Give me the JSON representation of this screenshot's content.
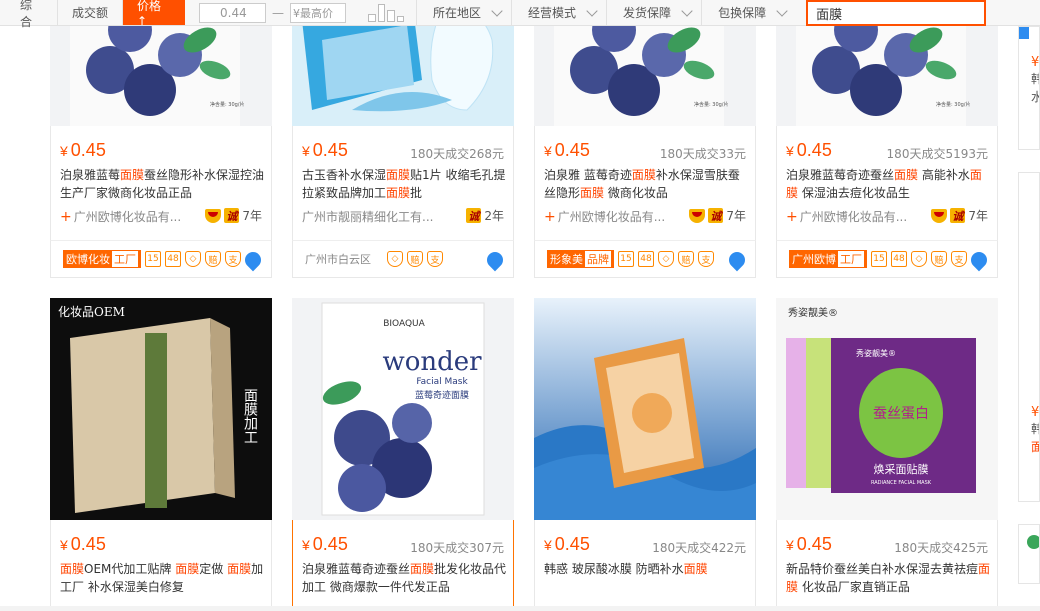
{
  "sort_bar": {
    "comprehensive": "综合",
    "volume": "成交额",
    "price": "价格 ↑",
    "price_min": "0.44",
    "price_dash": "—",
    "price_max_placeholder": "¥最高价",
    "filters": [
      "所在地区",
      "经营模式",
      "发货保障",
      "包换保障"
    ],
    "search_value": "面膜"
  },
  "products": [
    {
      "currency": "¥",
      "price": "0.45",
      "sold": "",
      "title_parts": [
        "泊泉雅蓝莓",
        "面膜",
        "蚕丝隐形补水保湿控油生产厂家微商化妆品正品"
      ],
      "shop": "广州欧博化妆品有...",
      "years": "7年",
      "foot_tag": "欧博化妆",
      "foot_tag_b": "工厂",
      "foot_icons": [
        "15",
        "48",
        "◇",
        "赔",
        "支"
      ]
    },
    {
      "currency": "¥",
      "price": "0.45",
      "sold": "180天成交268元",
      "title_parts": [
        "古玉香补水保湿",
        "面膜",
        "贴1片 收缩毛孔提拉紧致品牌加工",
        "面膜",
        "批"
      ],
      "shop": "广州市靓丽精细化工有...",
      "years": "2年",
      "foot_text": "广州市白云区",
      "foot_icons": [
        "◇",
        "赔",
        "支"
      ]
    },
    {
      "currency": "¥",
      "price": "0.45",
      "sold": "180天成交33元",
      "title_parts": [
        "泊泉雅 蓝莓奇迹",
        "面膜",
        "补水保湿雪肤蚕丝隐形",
        "面膜",
        " 微商化妆品"
      ],
      "shop": "广州欧博化妆品有...",
      "years": "7年",
      "foot_tag": "形象美",
      "foot_tag_b": "品牌",
      "foot_icons": [
        "15",
        "48",
        "◇",
        "赔",
        "支"
      ]
    },
    {
      "currency": "¥",
      "price": "0.45",
      "sold": "180天成交5193元",
      "title_parts": [
        "泊泉雅蓝莓奇迹蚕丝",
        "面膜",
        " 高能补水",
        "面膜",
        " 保湿油去痘化妆品生"
      ],
      "shop": "广州欧博化妆品有...",
      "years": "7年",
      "foot_tag": "广州欧博",
      "foot_tag_b": "工厂",
      "foot_icons": [
        "15",
        "48",
        "◇",
        "赔",
        "支"
      ]
    },
    {
      "currency": "¥",
      "price": "0.45",
      "sold": "",
      "title_parts": [
        "",
        "面膜",
        "OEM代加工贴牌 ",
        "面膜",
        "定做 ",
        "面膜",
        "加工厂 补水保湿美白修复"
      ],
      "img_text_top": "化妆品OEM",
      "img_text_side": "面膜加工"
    },
    {
      "currency": "¥",
      "price": "0.45",
      "sold": "180天成交307元",
      "title_parts": [
        "泊泉雅蓝莓奇迹蚕丝",
        "面膜",
        "批发化妆品代加工 微商爆款一件代发正品"
      ],
      "img_brand": "BIOAQUA",
      "img_word": "wonder",
      "img_sub": "Facial Mask",
      "img_cn": "蓝莓奇迹面膜"
    },
    {
      "currency": "¥",
      "price": "0.45",
      "sold": "180天成交422元",
      "title_parts": [
        "韩惑 玻尿酸冰膜 防晒补水",
        "面膜",
        ""
      ]
    },
    {
      "currency": "¥",
      "price": "0.45",
      "sold": "180天成交425元",
      "title_parts": [
        "新品特价蚕丝美白补水保湿去黄祛痘",
        "面膜",
        " 化妆品厂家直销正品"
      ],
      "img_brand": "秀姿靓美®",
      "img_cn": "焕采面贴膜",
      "img_en": "RADIANCE FACIAL MASK",
      "img_art": "蚕丝蛋白"
    }
  ],
  "right_strip": {
    "currency": "¥",
    "text1": "韩",
    "text2": "水",
    "text3": "韩",
    "text4": "面"
  },
  "colors": {
    "accent": "#ff5000",
    "highlight": "#f40"
  }
}
